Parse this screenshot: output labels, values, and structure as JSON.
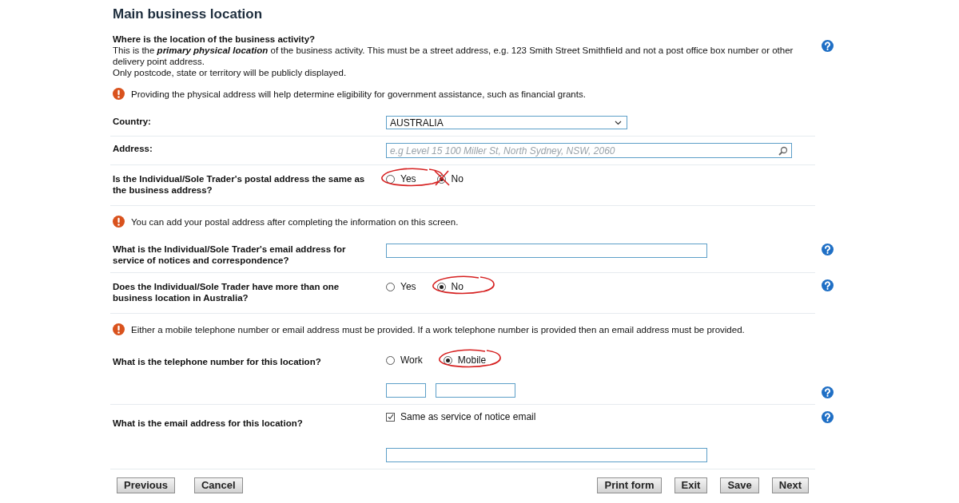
{
  "title": "Main business location",
  "intro": {
    "heading": "Where is the location of the business activity?",
    "lines": [
      "This is the **primary physical location** of the business activity. This must be a street address, e.g. 123 Smith Street Smithfield and not a post office box number or other delivery point address.",
      "Only postcode, state or territory will be publicly displayed."
    ],
    "help": true
  },
  "sections": [
    {
      "kind": "notice",
      "text": "Providing the physical address will help determine eligibility for government assistance, such as financial grants."
    },
    {
      "kind": "select",
      "label": "Country:",
      "value": "AUSTRALIA",
      "help": false
    },
    {
      "kind": "search",
      "label": "Address:",
      "placeholder": "e.g Level 15 100 Miller St, North Sydney, NSW, 2060",
      "help": false
    },
    {
      "kind": "radio",
      "label": "Is the Individual/Sole Trader's postal address the same as the business address?",
      "help": false,
      "options": [
        {
          "label": "Yes",
          "selected": false,
          "circled": true,
          "crossed": false
        },
        {
          "label": "No",
          "selected": true,
          "circled": false,
          "crossed": true
        }
      ]
    },
    {
      "kind": "notice",
      "text": "You can add your postal address after completing the information on this screen."
    },
    {
      "kind": "text",
      "label": "What is the Individual/Sole Trader's email address for service of notices and correspondence?",
      "help": true
    },
    {
      "kind": "radio",
      "label": "Does the Individual/Sole Trader have more than one business location in Australia?",
      "help": true,
      "options": [
        {
          "label": "Yes",
          "selected": false,
          "circled": false,
          "crossed": false
        },
        {
          "label": "No",
          "selected": true,
          "circled": true,
          "crossed": false
        }
      ]
    },
    {
      "kind": "notice",
      "text": "Either a mobile telephone number or email address must be provided. If a work telephone number is provided then an email address must be provided."
    },
    {
      "kind": "phone",
      "label": "What is the telephone number for this location?",
      "help": true,
      "options": [
        {
          "label": "Work",
          "selected": false,
          "circled": false,
          "crossed": false
        },
        {
          "label": "Mobile",
          "selected": true,
          "circled": true,
          "crossed": false
        }
      ]
    },
    {
      "kind": "email-copy",
      "label": "What is the email address for this location?",
      "help": true,
      "checkbox": {
        "label": "Same as service of notice email",
        "checked": true
      }
    }
  ],
  "buttons_left": [
    "Previous",
    "Cancel"
  ],
  "buttons_right": [
    "Print form",
    "Exit",
    "Save",
    "Next"
  ]
}
